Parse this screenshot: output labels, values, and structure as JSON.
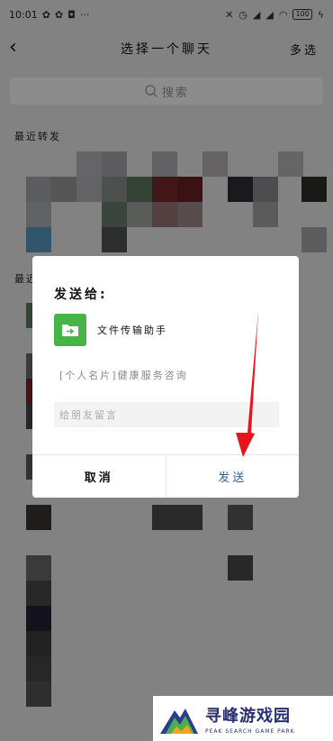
{
  "status_bar": {
    "time": "10:01",
    "battery": "100"
  },
  "nav": {
    "title": "选择一个聊天",
    "multi_select": "多选"
  },
  "search": {
    "placeholder": "搜索"
  },
  "sections": {
    "recent_forward": "最近转发",
    "recent_chats": "最近"
  },
  "dialog": {
    "title": "发送给:",
    "recipient": "文件传输助手",
    "card_text": "[个人名片]健康服务咨询",
    "message_placeholder": "给朋友留言",
    "cancel": "取消",
    "send": "发送"
  },
  "colors": {
    "accent_green": "#46b449",
    "send_blue": "#3a5f8f",
    "arrow_red": "#e8141c"
  },
  "watermark": {
    "chinese": "寻峰游戏园",
    "english": "PEAK SEARCH GAME PARK"
  }
}
